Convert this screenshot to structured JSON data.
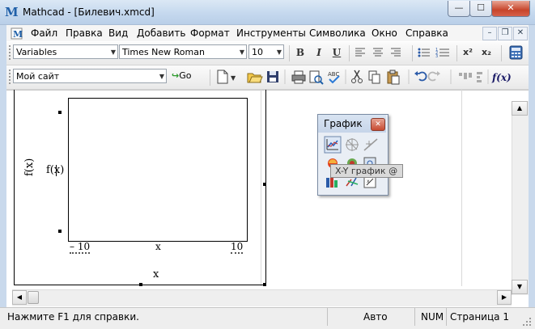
{
  "window": {
    "title": "Mathcad - [Билевич.xmcd]",
    "logo_letter": "M",
    "minimize": "—",
    "maximize": "☐",
    "close": "✕"
  },
  "menu": [
    "Файл",
    "Правка",
    "Вид",
    "Добавить",
    "Формат",
    "Инструменты",
    "Символика",
    "Окно",
    "Справка"
  ],
  "doc_controls": {
    "minimize": "–",
    "restore": "❐",
    "close": "✕"
  },
  "format_toolbar": {
    "style_value": "Variables",
    "font_value": "Times New Roman",
    "size_value": "10",
    "bold": "B",
    "italic": "I",
    "underline": "U",
    "superscript": "x²",
    "subscript": "x₂"
  },
  "standard_toolbar": {
    "address_value": "Мой сайт",
    "go_label": "Go"
  },
  "plot": {
    "y_axis_label": "f(x)",
    "y_placeholder": "f(x)",
    "x_min_label": "– 10",
    "x_axis_placeholder": "x",
    "x_max_label": "10",
    "x_axis_label": "x"
  },
  "palette": {
    "title": "График",
    "tooltip": "X-Y график @"
  },
  "statusbar": {
    "help": "Нажмите F1 для справки.",
    "mode": "Авто",
    "num": "NUM",
    "page": "Страница 1"
  },
  "colors": {
    "titlebar": "#c5d8ee",
    "close_button": "#c7452b",
    "accent": "#1f5fa8"
  }
}
